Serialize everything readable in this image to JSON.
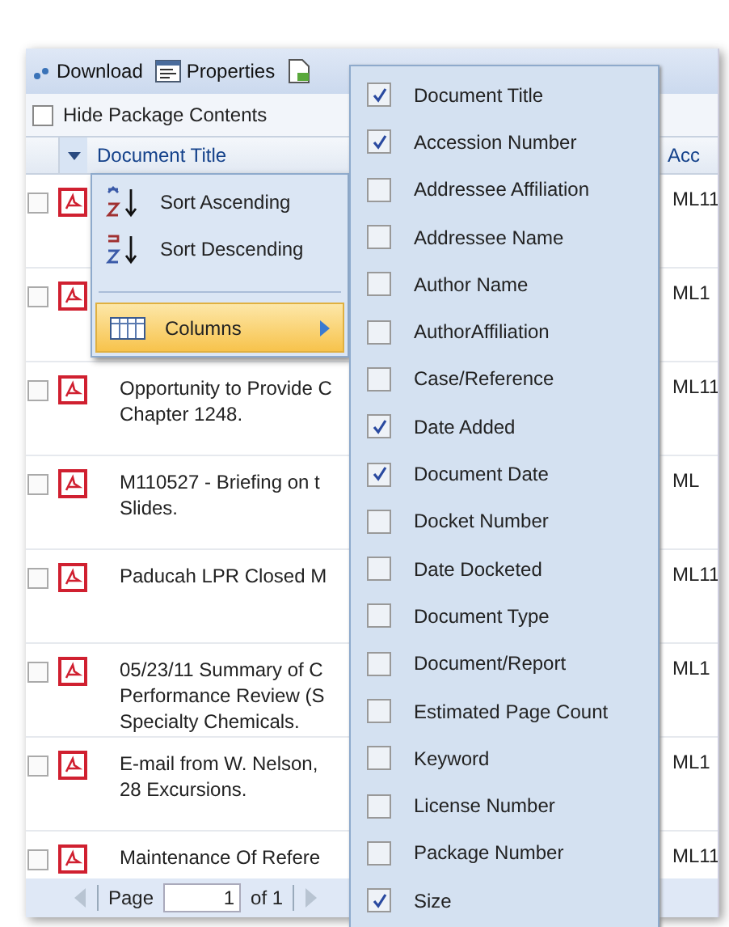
{
  "toolbar": [
    {
      "kind": "download",
      "label": "Download"
    },
    {
      "kind": "properties",
      "label": "Properties"
    }
  ],
  "hide_package_contents": {
    "label": "Hide Package Contents",
    "checked": false
  },
  "table": {
    "columns": [
      "Document Title",
      "Acc"
    ],
    "rows": [
      {
        "checked": false,
        "accession": "ML11"
      },
      {
        "checked": false,
        "accession": "ML1"
      },
      {
        "checked": false,
        "title_lines": [
          "Opportunity to Provide C",
          "Chapter 1248."
        ],
        "accession": "ML11"
      },
      {
        "checked": false,
        "title_lines": [
          "M110527 - Briefing on t",
          "Slides."
        ],
        "accession": "ML"
      },
      {
        "checked": false,
        "title_lines": [
          "Paducah LPR Closed M"
        ],
        "accession": "ML11"
      },
      {
        "checked": false,
        "title_lines": [
          "05/23/11 Summary of C",
          "Performance Review (S",
          "Specialty Chemicals."
        ],
        "accession": "ML1"
      },
      {
        "checked": false,
        "title_lines": [
          "E-mail from W. Nelson,",
          "28 Excursions."
        ],
        "accession": "ML1"
      },
      {
        "checked": false,
        "title_lines": [
          "Maintenance Of Refere"
        ],
        "accession": "ML11"
      }
    ]
  },
  "pager": {
    "label": "Page",
    "value": "1",
    "of": "of 1"
  },
  "sort_menu": [
    {
      "kind": "ascending",
      "label": "Sort Ascending",
      "selected": false
    },
    {
      "kind": "descending",
      "label": "Sort Descending",
      "selected": false
    },
    {
      "kind": "columns",
      "label": "Columns",
      "selected": true
    }
  ],
  "columns_menu": [
    {
      "label": "Document Title",
      "checked": true
    },
    {
      "label": "Accession Number",
      "checked": true
    },
    {
      "label": "Addressee Affiliation",
      "checked": false
    },
    {
      "label": "Addressee Name",
      "checked": false
    },
    {
      "label": "Author Name",
      "checked": false
    },
    {
      "label": "AuthorAffiliation",
      "checked": false
    },
    {
      "label": "Case/Reference",
      "checked": false
    },
    {
      "label": "Date Added",
      "checked": true
    },
    {
      "label": "Document Date",
      "checked": true
    },
    {
      "label": "Docket Number",
      "checked": false
    },
    {
      "label": "Date Docketed",
      "checked": false
    },
    {
      "label": "Document Type",
      "checked": false
    },
    {
      "label": "Document/Report",
      "checked": false
    },
    {
      "label": "Estimated Page Count",
      "checked": false
    },
    {
      "label": "Keyword",
      "checked": false
    },
    {
      "label": "License Number",
      "checked": false
    },
    {
      "label": "Package Number",
      "checked": false
    },
    {
      "label": "Size",
      "checked": true
    }
  ]
}
